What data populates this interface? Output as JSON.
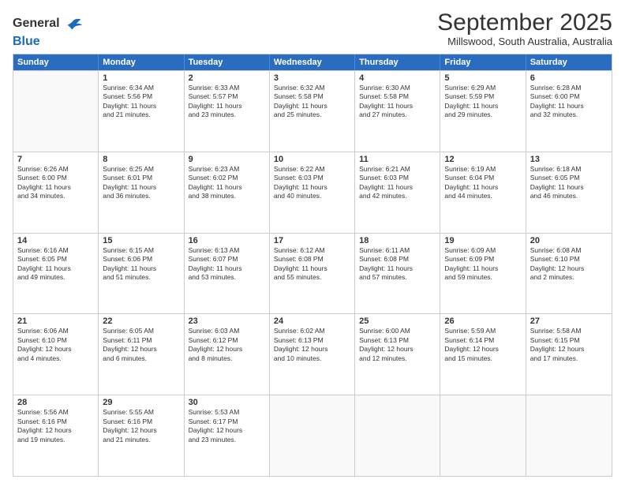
{
  "logo": {
    "line1": "General",
    "line2": "Blue"
  },
  "title": "September 2025",
  "subtitle": "Millswood, South Australia, Australia",
  "header_days": [
    "Sunday",
    "Monday",
    "Tuesday",
    "Wednesday",
    "Thursday",
    "Friday",
    "Saturday"
  ],
  "weeks": [
    [
      {
        "day": "",
        "lines": []
      },
      {
        "day": "1",
        "lines": [
          "Sunrise: 6:34 AM",
          "Sunset: 5:56 PM",
          "Daylight: 11 hours",
          "and 21 minutes."
        ]
      },
      {
        "day": "2",
        "lines": [
          "Sunrise: 6:33 AM",
          "Sunset: 5:57 PM",
          "Daylight: 11 hours",
          "and 23 minutes."
        ]
      },
      {
        "day": "3",
        "lines": [
          "Sunrise: 6:32 AM",
          "Sunset: 5:58 PM",
          "Daylight: 11 hours",
          "and 25 minutes."
        ]
      },
      {
        "day": "4",
        "lines": [
          "Sunrise: 6:30 AM",
          "Sunset: 5:58 PM",
          "Daylight: 11 hours",
          "and 27 minutes."
        ]
      },
      {
        "day": "5",
        "lines": [
          "Sunrise: 6:29 AM",
          "Sunset: 5:59 PM",
          "Daylight: 11 hours",
          "and 29 minutes."
        ]
      },
      {
        "day": "6",
        "lines": [
          "Sunrise: 6:28 AM",
          "Sunset: 6:00 PM",
          "Daylight: 11 hours",
          "and 32 minutes."
        ]
      }
    ],
    [
      {
        "day": "7",
        "lines": [
          "Sunrise: 6:26 AM",
          "Sunset: 6:00 PM",
          "Daylight: 11 hours",
          "and 34 minutes."
        ]
      },
      {
        "day": "8",
        "lines": [
          "Sunrise: 6:25 AM",
          "Sunset: 6:01 PM",
          "Daylight: 11 hours",
          "and 36 minutes."
        ]
      },
      {
        "day": "9",
        "lines": [
          "Sunrise: 6:23 AM",
          "Sunset: 6:02 PM",
          "Daylight: 11 hours",
          "and 38 minutes."
        ]
      },
      {
        "day": "10",
        "lines": [
          "Sunrise: 6:22 AM",
          "Sunset: 6:03 PM",
          "Daylight: 11 hours",
          "and 40 minutes."
        ]
      },
      {
        "day": "11",
        "lines": [
          "Sunrise: 6:21 AM",
          "Sunset: 6:03 PM",
          "Daylight: 11 hours",
          "and 42 minutes."
        ]
      },
      {
        "day": "12",
        "lines": [
          "Sunrise: 6:19 AM",
          "Sunset: 6:04 PM",
          "Daylight: 11 hours",
          "and 44 minutes."
        ]
      },
      {
        "day": "13",
        "lines": [
          "Sunrise: 6:18 AM",
          "Sunset: 6:05 PM",
          "Daylight: 11 hours",
          "and 46 minutes."
        ]
      }
    ],
    [
      {
        "day": "14",
        "lines": [
          "Sunrise: 6:16 AM",
          "Sunset: 6:05 PM",
          "Daylight: 11 hours",
          "and 49 minutes."
        ]
      },
      {
        "day": "15",
        "lines": [
          "Sunrise: 6:15 AM",
          "Sunset: 6:06 PM",
          "Daylight: 11 hours",
          "and 51 minutes."
        ]
      },
      {
        "day": "16",
        "lines": [
          "Sunrise: 6:13 AM",
          "Sunset: 6:07 PM",
          "Daylight: 11 hours",
          "and 53 minutes."
        ]
      },
      {
        "day": "17",
        "lines": [
          "Sunrise: 6:12 AM",
          "Sunset: 6:08 PM",
          "Daylight: 11 hours",
          "and 55 minutes."
        ]
      },
      {
        "day": "18",
        "lines": [
          "Sunrise: 6:11 AM",
          "Sunset: 6:08 PM",
          "Daylight: 11 hours",
          "and 57 minutes."
        ]
      },
      {
        "day": "19",
        "lines": [
          "Sunrise: 6:09 AM",
          "Sunset: 6:09 PM",
          "Daylight: 11 hours",
          "and 59 minutes."
        ]
      },
      {
        "day": "20",
        "lines": [
          "Sunrise: 6:08 AM",
          "Sunset: 6:10 PM",
          "Daylight: 12 hours",
          "and 2 minutes."
        ]
      }
    ],
    [
      {
        "day": "21",
        "lines": [
          "Sunrise: 6:06 AM",
          "Sunset: 6:10 PM",
          "Daylight: 12 hours",
          "and 4 minutes."
        ]
      },
      {
        "day": "22",
        "lines": [
          "Sunrise: 6:05 AM",
          "Sunset: 6:11 PM",
          "Daylight: 12 hours",
          "and 6 minutes."
        ]
      },
      {
        "day": "23",
        "lines": [
          "Sunrise: 6:03 AM",
          "Sunset: 6:12 PM",
          "Daylight: 12 hours",
          "and 8 minutes."
        ]
      },
      {
        "day": "24",
        "lines": [
          "Sunrise: 6:02 AM",
          "Sunset: 6:13 PM",
          "Daylight: 12 hours",
          "and 10 minutes."
        ]
      },
      {
        "day": "25",
        "lines": [
          "Sunrise: 6:00 AM",
          "Sunset: 6:13 PM",
          "Daylight: 12 hours",
          "and 12 minutes."
        ]
      },
      {
        "day": "26",
        "lines": [
          "Sunrise: 5:59 AM",
          "Sunset: 6:14 PM",
          "Daylight: 12 hours",
          "and 15 minutes."
        ]
      },
      {
        "day": "27",
        "lines": [
          "Sunrise: 5:58 AM",
          "Sunset: 6:15 PM",
          "Daylight: 12 hours",
          "and 17 minutes."
        ]
      }
    ],
    [
      {
        "day": "28",
        "lines": [
          "Sunrise: 5:56 AM",
          "Sunset: 6:16 PM",
          "Daylight: 12 hours",
          "and 19 minutes."
        ]
      },
      {
        "day": "29",
        "lines": [
          "Sunrise: 5:55 AM",
          "Sunset: 6:16 PM",
          "Daylight: 12 hours",
          "and 21 minutes."
        ]
      },
      {
        "day": "30",
        "lines": [
          "Sunrise: 5:53 AM",
          "Sunset: 6:17 PM",
          "Daylight: 12 hours",
          "and 23 minutes."
        ]
      },
      {
        "day": "",
        "lines": []
      },
      {
        "day": "",
        "lines": []
      },
      {
        "day": "",
        "lines": []
      },
      {
        "day": "",
        "lines": []
      }
    ]
  ]
}
